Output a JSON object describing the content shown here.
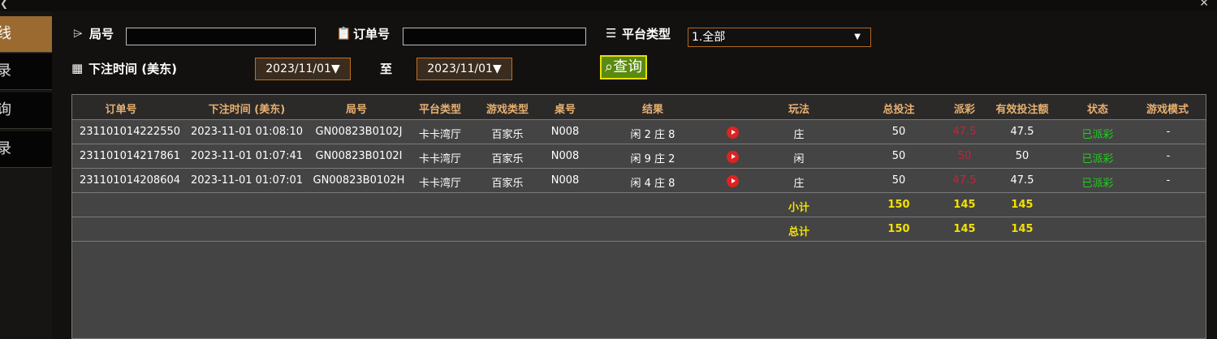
{
  "sidebar": {
    "items": [
      "线",
      "录",
      "询",
      "录"
    ]
  },
  "filters": {
    "round_label": "局号",
    "round_value": "",
    "order_label": "订单号",
    "order_value": "",
    "platform_label": "平台类型",
    "platform_value": "1.全部",
    "bet_time_label": "下注时间 (美东)",
    "date_from": "2023/11/01▼",
    "to_label": "至",
    "date_to": "2023/11/01▼",
    "query_label": "查询"
  },
  "table": {
    "headers": [
      "订单号",
      "下注时间 (美东)",
      "局号",
      "平台类型",
      "游戏类型",
      "桌号",
      "结果",
      "",
      "玩法",
      "总投注",
      "派彩",
      "有效投注额",
      "状态",
      "游戏模式"
    ],
    "rows": [
      [
        "231101014222550",
        "2023-11-01 01:08:10",
        "GN00823B0102J",
        "卡卡湾厅",
        "百家乐",
        "N008",
        "闲 2 庄 8",
        "",
        "庄",
        "50",
        "47.5",
        "47.5",
        "已派彩",
        "-"
      ],
      [
        "231101014217861",
        "2023-11-01 01:07:41",
        "GN00823B0102I",
        "卡卡湾厅",
        "百家乐",
        "N008",
        "闲 9 庄 2",
        "",
        "闲",
        "50",
        "50",
        "50",
        "已派彩",
        "-"
      ],
      [
        "231101014208604",
        "2023-11-01 01:07:01",
        "GN00823B0102H",
        "卡卡湾厅",
        "百家乐",
        "N008",
        "闲 4 庄 8",
        "",
        "庄",
        "50",
        "47.5",
        "47.5",
        "已派彩",
        "-"
      ]
    ],
    "subtotal": {
      "label": "小计",
      "total_bet": "150",
      "payout": "145",
      "valid_bet": "145"
    },
    "total": {
      "label": "总计",
      "total_bet": "150",
      "payout": "145",
      "valid_bet": "145"
    }
  },
  "colors": {
    "accent": "#9a6a30",
    "status_paid": "#22cc22",
    "payout_red": "#c0253a",
    "summary_yellow": "#f2e100"
  }
}
